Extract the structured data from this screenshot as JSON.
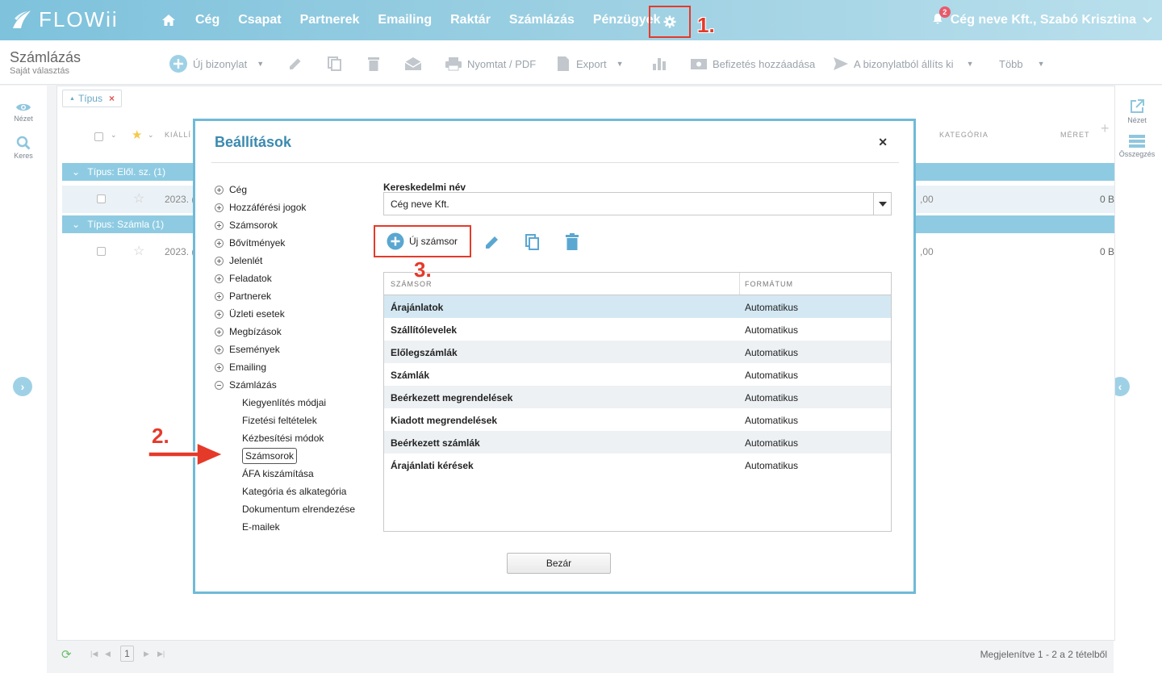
{
  "brand": {
    "name": "FLOWii"
  },
  "nav": {
    "items": [
      "Cég",
      "Csapat",
      "Partnerek",
      "Emailing",
      "Raktár",
      "Számlázás",
      "Pénzügyek"
    ]
  },
  "user": {
    "name": "Cég neve Kft., Szabó Krisztina",
    "notifications": "2"
  },
  "annotations": {
    "step1": "1.",
    "step2": "2.",
    "step3": "3."
  },
  "page": {
    "title": "Számlázás",
    "subtitle": "Saját választás"
  },
  "toolbar": {
    "new": "Új bizonylat",
    "print": "Nyomtat / PDF",
    "export": "Export",
    "payment": "Befizetés hozzáadása",
    "convert": "A bizonylatból állíts ki",
    "more": "Több"
  },
  "left_rail": {
    "view": "Nézet",
    "search": "Keres"
  },
  "right_rail": {
    "view": "Nézet",
    "summary": "Összegzés"
  },
  "filter": {
    "label": "Típus"
  },
  "grid": {
    "headers": {
      "issued": "KIÁLLÍ",
      "category": "KATEGÓRIA",
      "size": "MÉRET"
    },
    "groups": [
      {
        "label": "Típus: Elől. sz. (1)",
        "date": "2023. (",
        "amount": ",00",
        "size": "0 B"
      },
      {
        "label": "Típus: Számla (1)",
        "date": "2023. (",
        "amount": ",00",
        "size": "0 B"
      }
    ]
  },
  "footer": {
    "page": "1",
    "status": "Megjelenítve 1 - 2 a 2 tételből"
  },
  "modal": {
    "title": "Beállítások",
    "tree": [
      "Cég",
      "Hozzáférési jogok",
      "Számsorok",
      "Bővítmények",
      "Jelenlét",
      "Feladatok",
      "Partnerek",
      "Üzleti esetek",
      "Megbízások",
      "Események",
      "Emailing",
      "Számlázás"
    ],
    "subtree": [
      "Kiegyenlítés módjai",
      "Fizetési feltételek",
      "Kézbesítési módok",
      "Számsorok",
      "ÁFA kiszámítása",
      "Kategória és alkategória",
      "Dokumentum elrendezése",
      "E-mailek"
    ],
    "field_label": "Kereskedelmi név",
    "field_value": "Cég neve Kft.",
    "new_button": "Új számsor",
    "table": {
      "headers": [
        "SZÁMSOR",
        "FORMÁTUM"
      ],
      "rows": [
        [
          "Árajánlatok",
          "Automatikus"
        ],
        [
          "Szállítólevelek",
          "Automatikus"
        ],
        [
          "Előlegszámlák",
          "Automatikus"
        ],
        [
          "Számlák",
          "Automatikus"
        ],
        [
          "Beérkezett megrendelések",
          "Automatikus"
        ],
        [
          "Kiadott megrendelések",
          "Automatikus"
        ],
        [
          "Beérkezett számlák",
          "Automatikus"
        ],
        [
          "Árajánlati kérések",
          "Automatikus"
        ]
      ]
    },
    "close_button": "Bezár"
  }
}
